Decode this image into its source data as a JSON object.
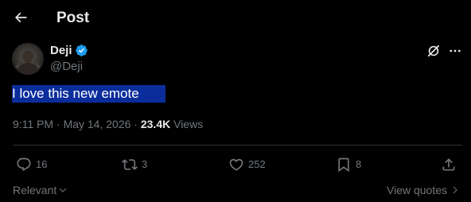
{
  "header": {
    "title": "Post",
    "back_icon": "arrow-left-icon"
  },
  "author": {
    "display_name": "Deji",
    "handle": "@Deji",
    "verified": true,
    "verified_color": "#1d9bf0"
  },
  "post": {
    "text": "I love this new emote",
    "highlight_color": "#0b2d9c"
  },
  "meta": {
    "time": "9:11 PM",
    "separator": "·",
    "date": "May 14, 2026",
    "views_count": "23.4K",
    "views_label": "Views"
  },
  "actions": {
    "replies": "16",
    "reposts": "3",
    "likes": "252",
    "bookmarks": "8"
  },
  "footer": {
    "sort_label": "Relevant",
    "view_quotes_label": "View quotes"
  },
  "colors": {
    "background": "#000000",
    "text_primary": "#e7e9ea",
    "text_secondary": "#71767b",
    "divider": "#2f3336"
  }
}
